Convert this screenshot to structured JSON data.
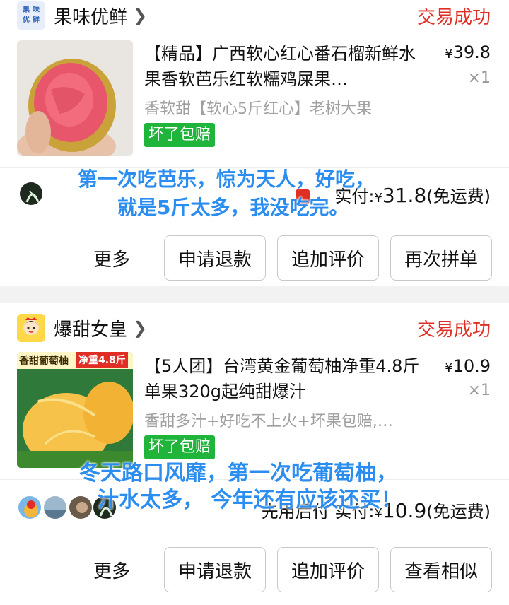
{
  "orders": [
    {
      "shop_name": "果味优鲜",
      "shop_logo_text": [
        "果",
        "味",
        "优",
        "鲜"
      ],
      "status": "交易成功",
      "title": "【精品】广西软心红心番石榴新鲜水果香软芭乐红软糯鸡屎果…",
      "price_symbol": "¥",
      "price": "39.8",
      "qty": "×1",
      "spec": "香软甜【软心5斤红心】老树大果",
      "tag": "坏了包赔",
      "paid_prefix": "实付:",
      "paid_symbol": "¥",
      "paid_amount": "31.8",
      "paid_note": "(免运费)",
      "overlay_lines": [
        "第一次吃芭乐，惊为天人，好吃，",
        "就是5斤太多，我没吃完。"
      ],
      "buttons": [
        "更多",
        "申请退款",
        "追加评价",
        "再次拼单"
      ]
    },
    {
      "shop_name": "爆甜女皇",
      "status": "交易成功",
      "title": "【5人团】台湾黄金葡萄柚净重4.8斤单果320g起纯甜爆汁",
      "price_symbol": "¥",
      "price": "10.9",
      "qty": "×1",
      "spec": "香甜多汁+好吃不上火+坏果包赔,…",
      "tag": "坏了包赔",
      "thumb_banner_left": "香甜葡萄柚",
      "thumb_banner_right": "净重4.8斤",
      "paid_prefix": "先用后付 实付:",
      "paid_symbol": "¥",
      "paid_amount": "10.9",
      "paid_note": "(免运费)",
      "overlay_lines": [
        "冬天路口风靡，第一次吃葡萄柚，",
        "汁水太多， 今年还有应该还买！"
      ],
      "buttons": [
        "更多",
        "申请退款",
        "追加评价",
        "查看相似"
      ]
    }
  ],
  "colors": {
    "status_red": "#e02e24",
    "tag_green": "#1fb53a",
    "overlay_blue": "#2b8df0"
  }
}
